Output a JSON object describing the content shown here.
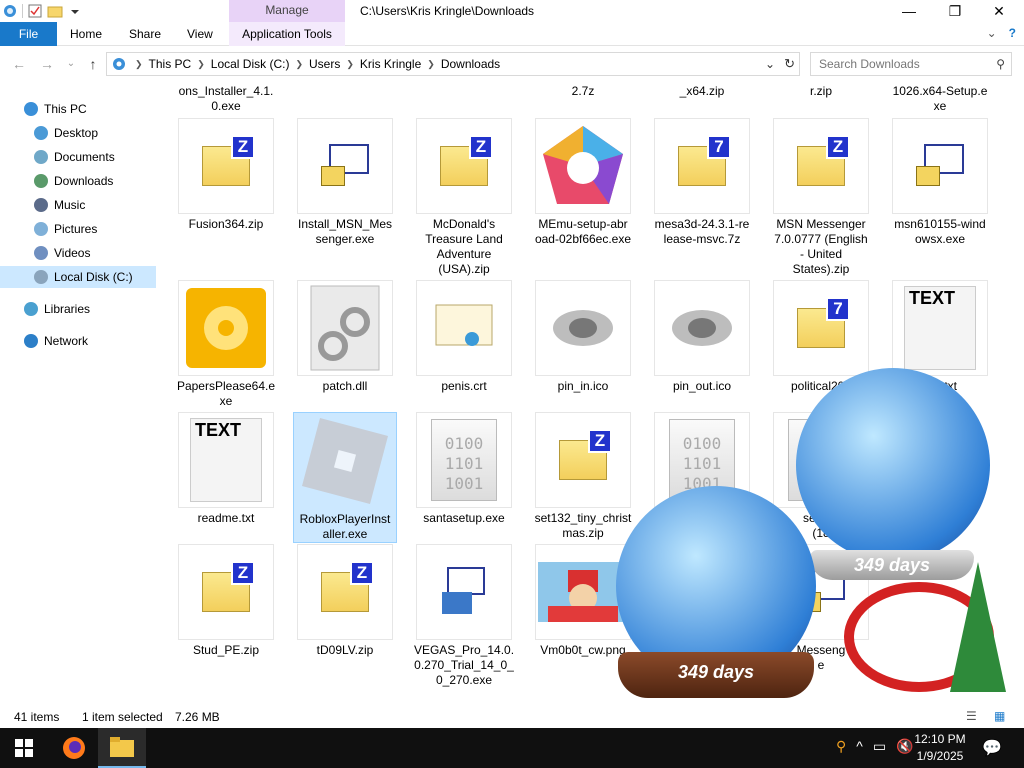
{
  "window": {
    "title": "C:\\Users\\Kris Kringle\\Downloads",
    "manage_label": "Manage",
    "minimize": "—",
    "maximize": "❐",
    "close": "✕"
  },
  "ribbon": {
    "file": "File",
    "home": "Home",
    "share": "Share",
    "view": "View",
    "app_tools": "Application Tools"
  },
  "address": {
    "crumbs": [
      "This PC",
      "Local Disk (C:)",
      "Users",
      "Kris Kringle",
      "Downloads"
    ],
    "search_placeholder": "Search Downloads"
  },
  "nav": {
    "this_pc": "This PC",
    "desktop": "Desktop",
    "documents": "Documents",
    "downloads": "Downloads",
    "music": "Music",
    "pictures": "Pictures",
    "videos": "Videos",
    "local_disk": "Local Disk (C:)",
    "libraries": "Libraries",
    "network": "Network"
  },
  "partial_row": [
    "ons_Installer_4.1.\n0.exe",
    "2.7z",
    "_x64.zip",
    "r.zip",
    "1026.x64-Setup.e\nxe"
  ],
  "files": [
    {
      "name": "Fusion364.zip",
      "kind": "zip",
      "badge": "Z"
    },
    {
      "name": "Install_MSN_Mes\nsenger.exe",
      "kind": "exe"
    },
    {
      "name": "McDonald's\nTreasure Land\nAdventure\n(USA).zip",
      "kind": "zip",
      "badge": "Z"
    },
    {
      "name": "MEmu-setup-abr\noad-02bf66ec.exe",
      "kind": "memu"
    },
    {
      "name": "mesa3d-24.3.1-re\nlease-msvc.7z",
      "kind": "zip",
      "badge": "7"
    },
    {
      "name": "MSN Messenger\n7.0.0777 (English\n- United\nStates).zip",
      "kind": "zip",
      "badge": "Z"
    },
    {
      "name": "msn610155-wind\nowsx.exe",
      "kind": "exe"
    },
    {
      "name": "PapersPlease64.e\nxe",
      "kind": "disc"
    },
    {
      "name": "patch.dll",
      "kind": "dll"
    },
    {
      "name": "penis.crt",
      "kind": "cert"
    },
    {
      "name": "pin_in.ico",
      "kind": "ico"
    },
    {
      "name": "pin_out.ico",
      "kind": "ico"
    },
    {
      "name": "political202",
      "kind": "zip",
      "badge": "7"
    },
    {
      "name": "ME.txt",
      "kind": "text"
    },
    {
      "name": "readme.txt",
      "kind": "text"
    },
    {
      "name": "RobloxPlayerInst\naller.exe",
      "kind": "roblox"
    },
    {
      "name": "santasetup.exe",
      "kind": "bin"
    },
    {
      "name": "set132_tiny_christ\nmas.zip",
      "kind": "zip",
      "badge": "Z"
    },
    {
      "name": "",
      "kind": "bin"
    },
    {
      "name": "setup_\n(18",
      "kind": "bin"
    },
    {
      "name": "Stud_PE.zip",
      "kind": "zip",
      "badge": "Z"
    },
    {
      "name": "tD09LV.zip",
      "kind": "zip",
      "badge": "Z"
    },
    {
      "name": "VEGAS_Pro_14.0.\n0.270_Trial_14_0_\n0_270.exe",
      "kind": "setup"
    },
    {
      "name": "Vm0b0t_cw.png",
      "kind": "png"
    },
    {
      "name": "Messeng\ne",
      "kind": "exe"
    }
  ],
  "globes": {
    "front": "349 days",
    "back": "349 days"
  },
  "status": {
    "count": "41 items",
    "selected": "1 item selected",
    "size": "7.26 MB"
  },
  "taskbar": {
    "time": "12:10 PM",
    "date": "1/9/2025"
  },
  "colors": {
    "accent": "#1979ca",
    "manage": "#e8d3f7",
    "selection": "#cce8ff"
  }
}
